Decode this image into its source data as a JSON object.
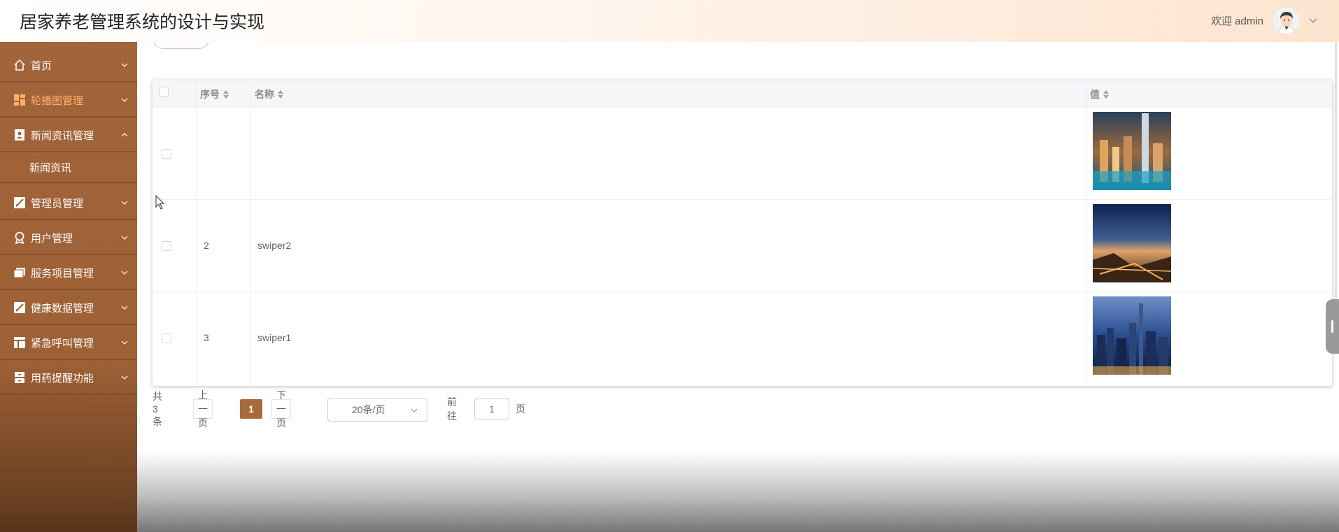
{
  "header": {
    "app_title": "居家养老管理系统的设计与实现",
    "welcome": "欢迎 admin"
  },
  "sidebar": {
    "items": [
      {
        "label": "首页",
        "icon": "home-icon"
      },
      {
        "label": "轮播图管理",
        "icon": "dashboard-icon",
        "active": true
      },
      {
        "label": "新闻资讯管理",
        "icon": "contact-card-icon",
        "expanded": true
      },
      {
        "label": "新闻资讯",
        "submenu": true
      },
      {
        "label": "管理员管理",
        "icon": "edit-box-icon"
      },
      {
        "label": "用户管理",
        "icon": "badge-icon"
      },
      {
        "label": "服务项目管理",
        "icon": "folder-icon"
      },
      {
        "label": "健康数据管理",
        "icon": "edit-box-icon"
      },
      {
        "label": "紧急呼叫管理",
        "icon": "layout-icon"
      },
      {
        "label": "用药提醒功能",
        "icon": "storage-icon"
      }
    ]
  },
  "table": {
    "columns": [
      "序号",
      "名称",
      "值"
    ],
    "rows": [
      {
        "index": "",
        "name": "",
        "image": "city-night-thumbnail"
      },
      {
        "index": "2",
        "name": "swiper2",
        "image": "city-sunset-thumbnail"
      },
      {
        "index": "3",
        "name": "swiper1",
        "image": "city-skyline-thumbnail"
      }
    ]
  },
  "pagination": {
    "total": "共 3 条",
    "prev": "上一页",
    "current": "1",
    "next": "下一页",
    "page_size": "20条/页",
    "goto_label": "前往",
    "goto_value": "1",
    "goto_suffix": "页"
  },
  "colors": {
    "sidebar": "#a2643a",
    "active_text": "#ffb16b",
    "pager_current": "#a86a3d"
  }
}
